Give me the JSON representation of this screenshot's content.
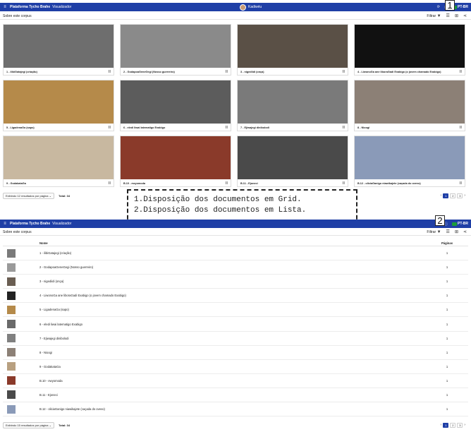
{
  "app": {
    "name": "Plataforma Tycho Brahe",
    "section": "Visualizador"
  },
  "user": {
    "name": "Kadiwéu"
  },
  "lang": "PT-BR",
  "corpus_link": "Sobre este corpus",
  "filter_label": "Filtrar",
  "grid_view": {
    "items": [
      {
        "title": "1 - ilibiGatajegi (criação)",
        "thumb": "#6e6e6e"
      },
      {
        "title": "2 - GodapoaGeneGegi (Nosso guerreiro)",
        "thumb": "#8a8a8a"
      },
      {
        "title": "3 - nigediidi (onça)",
        "thumb": "#5a5046"
      },
      {
        "title": "4 - LiwonoGa ane liboraGadi Exabigo (o jovem chamado Exabigo)",
        "thumb": "#111111"
      },
      {
        "title": "5 - LigadenaGa (sapo)",
        "thumb": "#b58a4a"
      },
      {
        "title": "6 - eledi liwai latematigo Exabigo",
        "thumb": "#5c5c5c"
      },
      {
        "title": "7 - Ejiwajegi dinibolodi",
        "thumb": "#7a7a7a"
      },
      {
        "title": "8 - Nioogi",
        "thumb": "#8c8076"
      },
      {
        "title": "9 - GodakataGa",
        "thumb": "#c8b8a0"
      },
      {
        "title": "B.10 - ewyomoda",
        "thumb": "#8a3a2a"
      },
      {
        "title": "B.11 - Ejoneci",
        "thumb": "#4a4a4a"
      },
      {
        "title": "B.12 - oliciaGanigo niawikajete (caçada do ovevo)",
        "thumb": "#8a9ab8"
      }
    ],
    "per_page": "Exibindo 12 resultados por página",
    "total": "Total: 34",
    "pages": [
      "1",
      "2",
      "3"
    ]
  },
  "legend": {
    "line1": "1.Disposição dos documentos em Grid.",
    "line2": "2.Disposição dos documentos em Lista."
  },
  "markers": {
    "grid": "1",
    "list": "2"
  },
  "list_view": {
    "col_name": "Nome",
    "col_pages": "Páginas",
    "rows": [
      {
        "name": "1 - ilibiGatajegi (criação)",
        "pages": "1",
        "thumb": "#7a7a7a"
      },
      {
        "name": "2 - GodapoaGeneGegi (Nosso guerreiro)",
        "pages": "1",
        "thumb": "#9a9a9a"
      },
      {
        "name": "3 - nigediidi (onça)",
        "pages": "1",
        "thumb": "#6a5e52"
      },
      {
        "name": "4 - LiwonoGa ane liboraGadi Exabigo (o jovem chamado Exabigo)",
        "pages": "1",
        "thumb": "#222222"
      },
      {
        "name": "5 - LigadenaGa (sapo)",
        "pages": "1",
        "thumb": "#b58a4a"
      },
      {
        "name": "6 - eledi liwai latematigo Exabigo",
        "pages": "1",
        "thumb": "#6a6a6a"
      },
      {
        "name": "7 - Ejiwajegi dinibolodi",
        "pages": "1",
        "thumb": "#808080"
      },
      {
        "name": "8 - Nioogi",
        "pages": "1",
        "thumb": "#8c8076"
      },
      {
        "name": "9 - GodakataGa",
        "pages": "1",
        "thumb": "#b8a080"
      },
      {
        "name": "B.10 - ewyomoda",
        "pages": "1",
        "thumb": "#8a3a2a"
      },
      {
        "name": "B.11 - Ejoneci",
        "pages": "1",
        "thumb": "#4a4a4a"
      },
      {
        "name": "B.12 - oliciaGanigo niawikajete (caçada do ovevo)",
        "pages": "1",
        "thumb": "#8a9ab8"
      }
    ],
    "per_page": "Exibindo 15 resultados por página",
    "total": "Total: 34",
    "pages": [
      "1",
      "2",
      "3"
    ]
  },
  "colors": {
    "brand": "#1f3fa6",
    "active_page": "#1f3fa6"
  }
}
